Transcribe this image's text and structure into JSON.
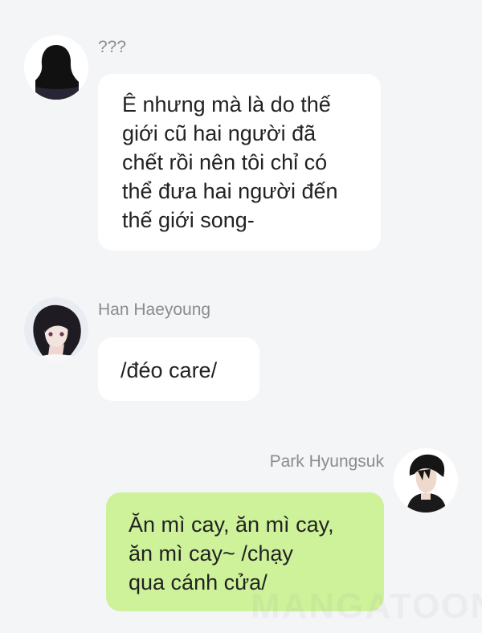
{
  "messages": [
    {
      "sender": "???",
      "text": "Ê nhưng mà là do thế\ngiới cũ hai người đã\nchết rồi nên tôi chỉ có\nthể đưa hai người đến\nthế giới song-"
    },
    {
      "sender": "Han Haeyoung",
      "text": "/đéo care/"
    },
    {
      "sender": "Park Hyungsuk",
      "text": "Ăn mì cay, ăn mì cay,\năn mì cay~ /chạy\nqua cánh cửa/"
    }
  ],
  "watermark": "MANGATOON",
  "colors": {
    "background": "#f4f5f7",
    "incoming_bubble": "#ffffff",
    "outgoing_bubble": "#cdf29a",
    "sender_name": "#8c8c8c"
  },
  "icons": [
    "silhouette-avatar-icon",
    "han-haeyoung-avatar-icon",
    "park-hyungsuk-avatar-icon"
  ]
}
